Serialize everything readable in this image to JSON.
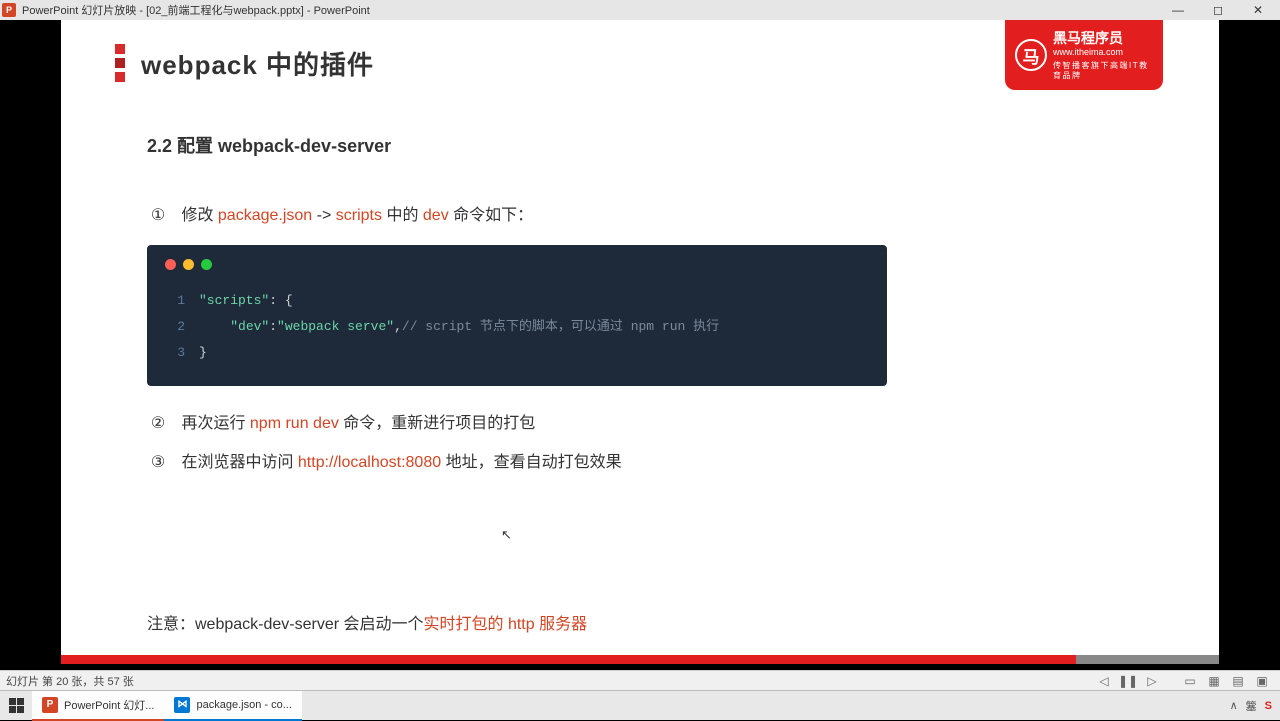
{
  "titlebar": {
    "icon_letter": "P",
    "text": "PowerPoint 幻灯片放映 - [02_前端工程化与webpack.pptx] - PowerPoint"
  },
  "brand": {
    "circle": "马",
    "line1": "黑马程序员",
    "line2": "www.itheima.com",
    "line3": "传智播客旗下高端IT教育品牌"
  },
  "slide": {
    "title": "webpack 中的插件",
    "subtitle": "2.2 配置 webpack-dev-server",
    "step1_num": "①",
    "step1_a": "修改 ",
    "step1_hl1": "package.json",
    "step1_b": " -> ",
    "step1_hl2": "scripts",
    "step1_c": " 中的 ",
    "step1_hl3": "dev",
    "step1_d": " 命令如下：",
    "code": {
      "l1_key": "\"scripts\"",
      "l1_pun": ": {",
      "l2_key": "\"dev\"",
      "l2_pun1": ": ",
      "l2_val": "\"webpack serve\"",
      "l2_pun2": ", ",
      "l2_com": "// script 节点下的脚本，可以通过 npm run 执行",
      "l3_pun": "}"
    },
    "step2_num": "②",
    "step2_a": "再次运行 ",
    "step2_hl": "npm run dev",
    "step2_b": " 命令，重新进行项目的打包",
    "step3_num": "③",
    "step3_a": "在浏览器中访问 ",
    "step3_hl": "http://localhost:8080",
    "step3_b": " 地址，查看自动打包效果",
    "note_a": "注意：webpack-dev-server 会启动一个",
    "note_hl": "实时打包的 http 服务器"
  },
  "statusbar": {
    "text": "幻灯片 第 20 张，共 57 张"
  },
  "taskbar": {
    "task1": "PowerPoint 幻灯...",
    "task2": "package.json - co...",
    "tray_up": "∧",
    "tray_ime": "簺",
    "tray_s": "S"
  }
}
